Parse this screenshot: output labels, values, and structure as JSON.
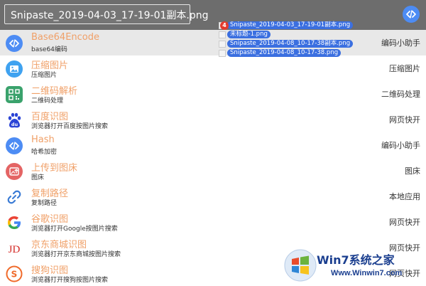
{
  "search": {
    "value": "Snipaste_2019-04-03_17-19-01副本.png"
  },
  "items": [
    {
      "title": "Base64Encode",
      "desc": "base64编码",
      "right": "编码小助手",
      "icon": "code-icon",
      "color": "#4d8cf4"
    },
    {
      "title": "压缩图片",
      "desc": "压缩图片",
      "right": "压缩图片",
      "icon": "image-icon",
      "color": "#3fa2f0"
    },
    {
      "title": "二维码解析",
      "desc": "二维码处理",
      "right": "二维码处理",
      "icon": "qrcode-icon",
      "color": "#3aa26c"
    },
    {
      "title": "百度识图",
      "desc": "浏览器打开百度按图片搜索",
      "right": "网页快开",
      "icon": "baidu-icon",
      "color": "#2b44d6"
    },
    {
      "title": "Hash",
      "desc": "哈希加密",
      "right": "编码小助手",
      "icon": "code-icon",
      "color": "#4d8cf4"
    },
    {
      "title": "上传到图床",
      "desc": "图床",
      "right": "图床",
      "icon": "upload-image-icon",
      "color": "#e46464"
    },
    {
      "title": "复制路径",
      "desc": "复制路径",
      "right": "本地应用",
      "icon": "link-icon",
      "color": "#3a7bd5"
    },
    {
      "title": "谷歌识图",
      "desc": "浏览器打开Google按图片搜索",
      "right": "网页快开",
      "icon": "google-icon",
      "color": "#4285f4"
    },
    {
      "title": "京东商城识图",
      "desc": "浏览器打开京东商城按图片搜索",
      "right": "网页快开",
      "icon": "jd-icon",
      "color": "#d42a26"
    },
    {
      "title": "搜狗识图",
      "desc": "浏览器打开搜狗按图片搜索",
      "right": "网页快开",
      "icon": "sogou-icon",
      "color": "#f06a2a"
    }
  ],
  "drag": {
    "count": "4",
    "files": [
      "Snipaste_2019-04-03_17-19-01副本.png",
      "未标题-1.png",
      "Snipaste_2019-04-08_10-17-38副本.png",
      "Snipaste_2019-04-08_10-17-38.png"
    ]
  },
  "watermark": {
    "brand": "Win7系统之家",
    "url": "Www.Winwin7.com"
  }
}
